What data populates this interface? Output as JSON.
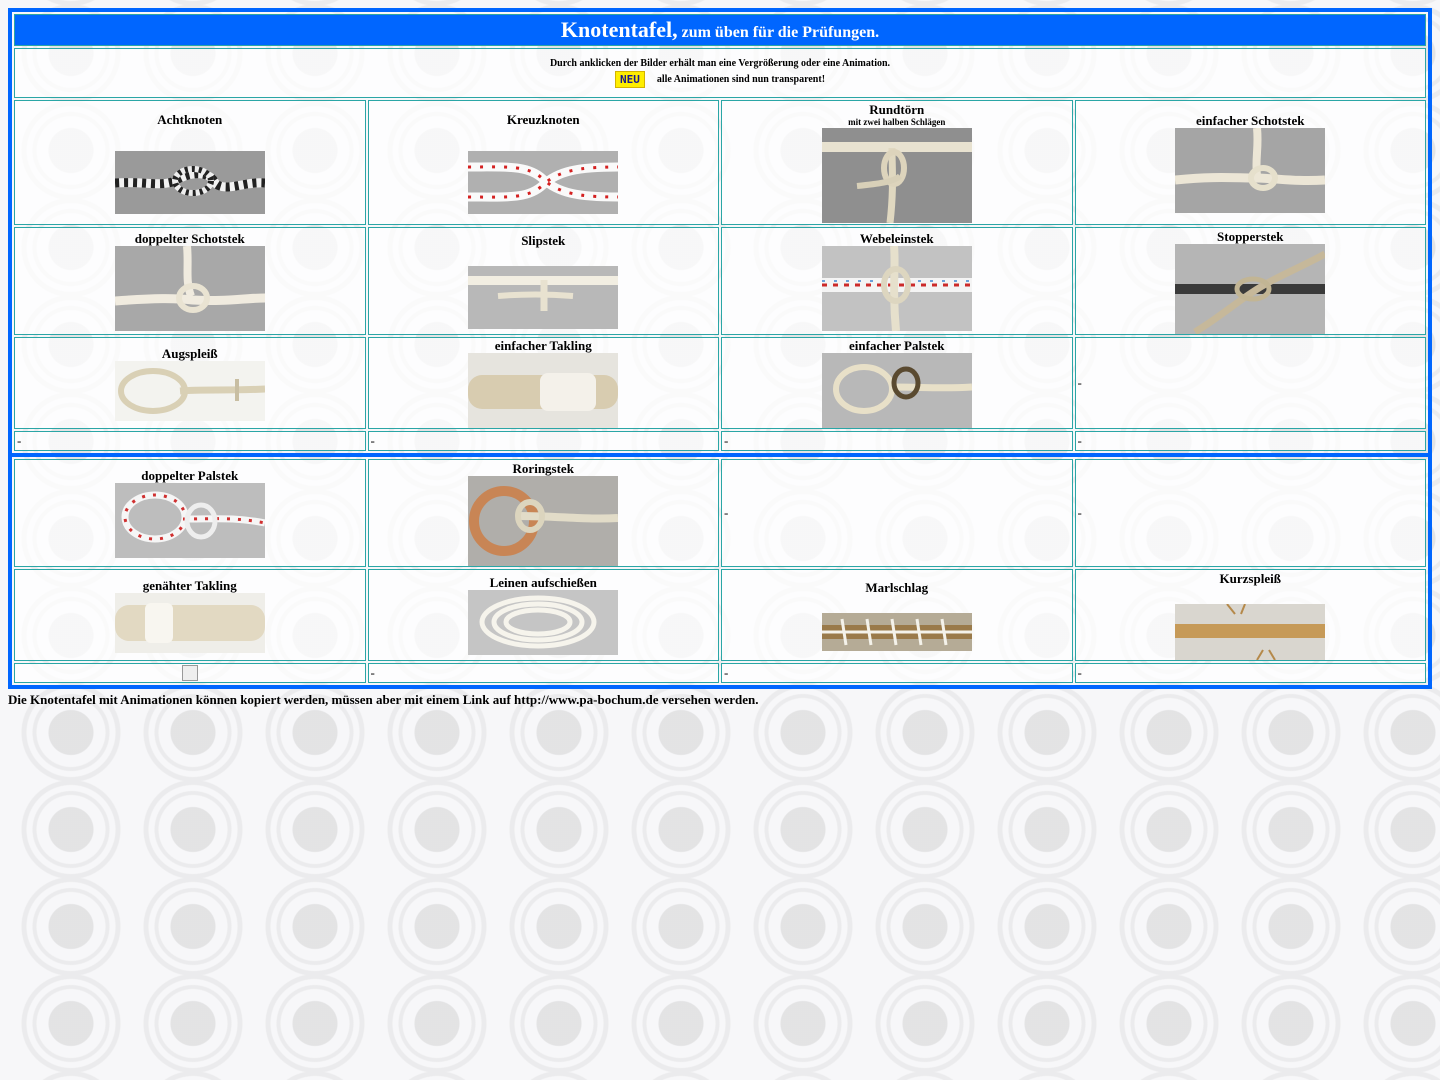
{
  "header": {
    "title": "Knotentafel,",
    "subtitle": " zum üben für die Prüfungen.",
    "info_line1": "Durch anklicken der Bilder erhält man eine Vergrößerung oder eine Animation.",
    "neu_badge": "NEU",
    "info_line2": "alle Animationen sind nun transparent!"
  },
  "table1": {
    "rows": [
      [
        {
          "label": "Achtknoten",
          "icon": "achtknoten-photo"
        },
        {
          "label": "Kreuzknoten",
          "icon": "kreuzknoten-photo"
        },
        {
          "label": "Rundtörn",
          "sub": "mit zwei halben Schlägen",
          "icon": "rundtoern-photo"
        },
        {
          "label": "einfacher Schotstek",
          "icon": "einfacher-schotstek-photo"
        }
      ],
      [
        {
          "label": "doppelter Schotstek",
          "icon": "doppelter-schotstek-photo"
        },
        {
          "label": "Slipstek",
          "icon": "slipstek-photo"
        },
        {
          "label": "Webeleinstek",
          "icon": "webeleinstek-photo"
        },
        {
          "label": "Stopperstek",
          "icon": "stopperstek-photo"
        }
      ],
      [
        {
          "label": "Augspleiß",
          "icon": "augspleiss-photo"
        },
        {
          "label": "einfacher Takling",
          "icon": "einfacher-takling-photo"
        },
        {
          "label": "einfacher Palstek",
          "icon": "einfacher-palstek-photo"
        },
        {
          "dash": "-"
        }
      ],
      [
        {
          "dash": "-"
        },
        {
          "dash": "-"
        },
        {
          "dash": "-"
        },
        {
          "dash": "-"
        }
      ]
    ]
  },
  "table2": {
    "rows": [
      [
        {
          "label": "doppelter Palstek",
          "icon": "doppelter-palstek-photo"
        },
        {
          "label": "Roringstek",
          "icon": "roringstek-photo"
        },
        {
          "dash": "-"
        },
        {
          "dash": "-"
        }
      ],
      [
        {
          "label": "genähter Takling",
          "icon": "genaehter-takling-photo"
        },
        {
          "label": "Leinen aufschießen",
          "icon": "leinen-aufschiessen-photo"
        },
        {
          "label": "Marlschlag",
          "icon": "marlschlag-photo"
        },
        {
          "label": "Kurzspleiß",
          "icon": "kurzspleiss-photo"
        }
      ],
      [
        {
          "broken_image": true,
          "icon": "broken-image-icon"
        },
        {
          "dash": "-"
        },
        {
          "dash": "-"
        },
        {
          "dash": "-"
        }
      ]
    ]
  },
  "footer": {
    "text": "Die Knotentafel mit Animationen können kopiert werden, müssen aber mit einem Link auf http://www.pa-bochum.de versehen werden."
  },
  "colors": {
    "frame_blue": "#0066ff",
    "cell_border": "#2aa6a6",
    "neu_yellow": "#ffee00"
  }
}
